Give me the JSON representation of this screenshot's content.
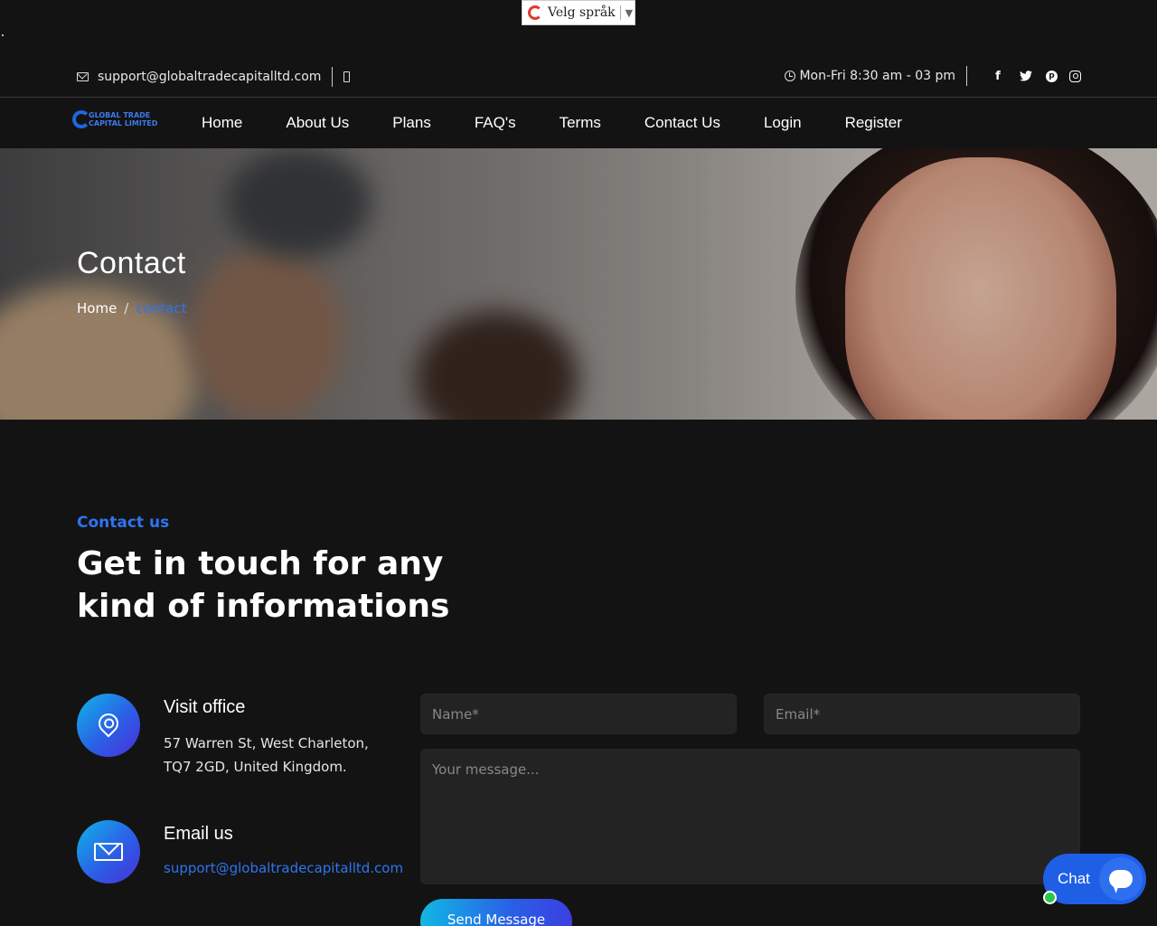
{
  "language_widget": {
    "label": "Velg språk",
    "caret": "▼"
  },
  "topbar": {
    "email": "support@globaltradecapitalltd.com",
    "hours": "Mon-Fri 8:30 am - 03 pm",
    "social": [
      "facebook-icon",
      "twitter-icon",
      "pinterest-icon",
      "instagram-icon"
    ]
  },
  "nav": {
    "logo_line1": "GLOBAL TRADE",
    "logo_line2": "CAPITAL LIMITED",
    "links": [
      "Home",
      "About Us",
      "Plans",
      "FAQ's",
      "Terms",
      "Contact Us",
      "Login",
      "Register"
    ]
  },
  "hero": {
    "title": "Contact",
    "breadcrumb": {
      "home": "Home",
      "separator": "/",
      "current": "contact"
    }
  },
  "section": {
    "kicker": "Contact us",
    "headline": "Get in touch for any kind of informations"
  },
  "info": {
    "office": {
      "title": "Visit office",
      "address": "57 Warren St, West Charleton,\nTQ7 2GD, United Kingdom."
    },
    "email": {
      "title": "Email us",
      "address": "support@globaltradecapitalltd.com"
    }
  },
  "form": {
    "name_placeholder": "Name*",
    "email_placeholder": "Email*",
    "message_placeholder": "Your message...",
    "send_label": "Send Message"
  },
  "chat": {
    "label": "Chat"
  },
  "colors": {
    "accent": "#2f74f0",
    "background": "#131313",
    "chat": "#1f5fe6",
    "online": "#2cc64f"
  }
}
